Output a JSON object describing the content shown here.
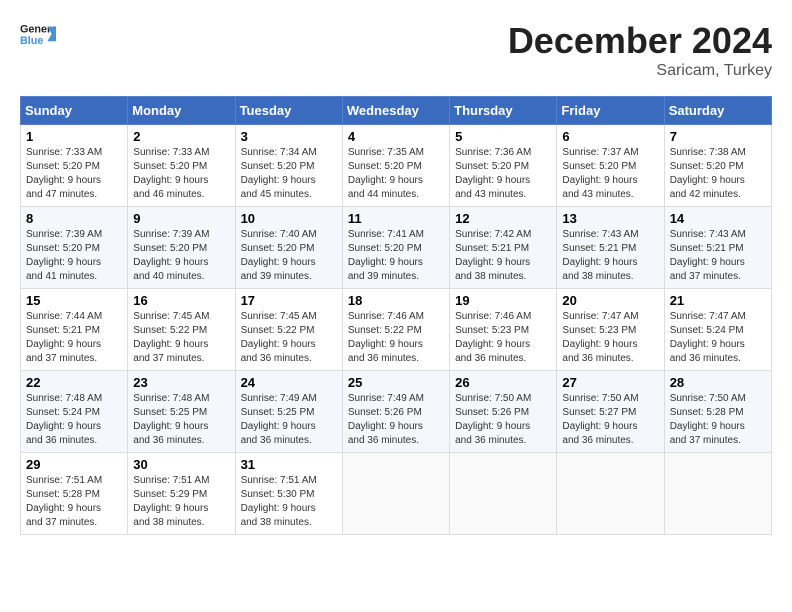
{
  "header": {
    "logo_line1": "General",
    "logo_line2": "Blue",
    "month": "December 2024",
    "location": "Saricam, Turkey"
  },
  "days_of_week": [
    "Sunday",
    "Monday",
    "Tuesday",
    "Wednesday",
    "Thursday",
    "Friday",
    "Saturday"
  ],
  "weeks": [
    [
      {
        "day": "1",
        "sunrise": "7:33 AM",
        "sunset": "5:20 PM",
        "daylight": "9 hours and 47 minutes."
      },
      {
        "day": "2",
        "sunrise": "7:33 AM",
        "sunset": "5:20 PM",
        "daylight": "9 hours and 46 minutes."
      },
      {
        "day": "3",
        "sunrise": "7:34 AM",
        "sunset": "5:20 PM",
        "daylight": "9 hours and 45 minutes."
      },
      {
        "day": "4",
        "sunrise": "7:35 AM",
        "sunset": "5:20 PM",
        "daylight": "9 hours and 44 minutes."
      },
      {
        "day": "5",
        "sunrise": "7:36 AM",
        "sunset": "5:20 PM",
        "daylight": "9 hours and 43 minutes."
      },
      {
        "day": "6",
        "sunrise": "7:37 AM",
        "sunset": "5:20 PM",
        "daylight": "9 hours and 43 minutes."
      },
      {
        "day": "7",
        "sunrise": "7:38 AM",
        "sunset": "5:20 PM",
        "daylight": "9 hours and 42 minutes."
      }
    ],
    [
      {
        "day": "8",
        "sunrise": "7:39 AM",
        "sunset": "5:20 PM",
        "daylight": "9 hours and 41 minutes."
      },
      {
        "day": "9",
        "sunrise": "7:39 AM",
        "sunset": "5:20 PM",
        "daylight": "9 hours and 40 minutes."
      },
      {
        "day": "10",
        "sunrise": "7:40 AM",
        "sunset": "5:20 PM",
        "daylight": "9 hours and 39 minutes."
      },
      {
        "day": "11",
        "sunrise": "7:41 AM",
        "sunset": "5:20 PM",
        "daylight": "9 hours and 39 minutes."
      },
      {
        "day": "12",
        "sunrise": "7:42 AM",
        "sunset": "5:21 PM",
        "daylight": "9 hours and 38 minutes."
      },
      {
        "day": "13",
        "sunrise": "7:43 AM",
        "sunset": "5:21 PM",
        "daylight": "9 hours and 38 minutes."
      },
      {
        "day": "14",
        "sunrise": "7:43 AM",
        "sunset": "5:21 PM",
        "daylight": "9 hours and 37 minutes."
      }
    ],
    [
      {
        "day": "15",
        "sunrise": "7:44 AM",
        "sunset": "5:21 PM",
        "daylight": "9 hours and 37 minutes."
      },
      {
        "day": "16",
        "sunrise": "7:45 AM",
        "sunset": "5:22 PM",
        "daylight": "9 hours and 37 minutes."
      },
      {
        "day": "17",
        "sunrise": "7:45 AM",
        "sunset": "5:22 PM",
        "daylight": "9 hours and 36 minutes."
      },
      {
        "day": "18",
        "sunrise": "7:46 AM",
        "sunset": "5:22 PM",
        "daylight": "9 hours and 36 minutes."
      },
      {
        "day": "19",
        "sunrise": "7:46 AM",
        "sunset": "5:23 PM",
        "daylight": "9 hours and 36 minutes."
      },
      {
        "day": "20",
        "sunrise": "7:47 AM",
        "sunset": "5:23 PM",
        "daylight": "9 hours and 36 minutes."
      },
      {
        "day": "21",
        "sunrise": "7:47 AM",
        "sunset": "5:24 PM",
        "daylight": "9 hours and 36 minutes."
      }
    ],
    [
      {
        "day": "22",
        "sunrise": "7:48 AM",
        "sunset": "5:24 PM",
        "daylight": "9 hours and 36 minutes."
      },
      {
        "day": "23",
        "sunrise": "7:48 AM",
        "sunset": "5:25 PM",
        "daylight": "9 hours and 36 minutes."
      },
      {
        "day": "24",
        "sunrise": "7:49 AM",
        "sunset": "5:25 PM",
        "daylight": "9 hours and 36 minutes."
      },
      {
        "day": "25",
        "sunrise": "7:49 AM",
        "sunset": "5:26 PM",
        "daylight": "9 hours and 36 minutes."
      },
      {
        "day": "26",
        "sunrise": "7:50 AM",
        "sunset": "5:26 PM",
        "daylight": "9 hours and 36 minutes."
      },
      {
        "day": "27",
        "sunrise": "7:50 AM",
        "sunset": "5:27 PM",
        "daylight": "9 hours and 36 minutes."
      },
      {
        "day": "28",
        "sunrise": "7:50 AM",
        "sunset": "5:28 PM",
        "daylight": "9 hours and 37 minutes."
      }
    ],
    [
      {
        "day": "29",
        "sunrise": "7:51 AM",
        "sunset": "5:28 PM",
        "daylight": "9 hours and 37 minutes."
      },
      {
        "day": "30",
        "sunrise": "7:51 AM",
        "sunset": "5:29 PM",
        "daylight": "9 hours and 38 minutes."
      },
      {
        "day": "31",
        "sunrise": "7:51 AM",
        "sunset": "5:30 PM",
        "daylight": "9 hours and 38 minutes."
      },
      null,
      null,
      null,
      null
    ]
  ]
}
